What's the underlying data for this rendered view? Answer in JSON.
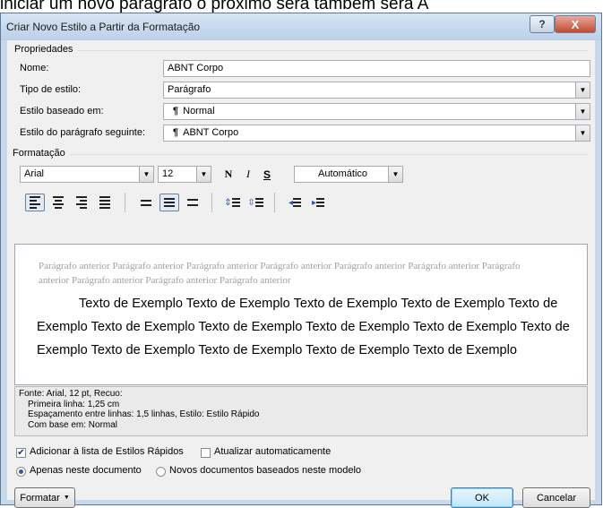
{
  "background_text": "iniciar um novo parágrafo o próximo será também será A",
  "window": {
    "title": "Criar Novo Estilo a Partir da Formatação",
    "help_label": "?",
    "close_label": "X"
  },
  "properties": {
    "section_label": "Propriedades",
    "name_label": "Nome:",
    "name_value": "ABNT Corpo",
    "style_type_label": "Tipo de estilo:",
    "style_type_value": "Parágrafo",
    "based_on_label": "Estilo baseado em:",
    "based_on_value": "Normal",
    "next_style_label": "Estilo do parágrafo seguinte:",
    "next_style_value": "ABNT Corpo",
    "paragraph_icon": "¶"
  },
  "formatting": {
    "section_label": "Formatação",
    "font": "Arial",
    "size": "12",
    "bold": "N",
    "italic": "I",
    "underline": "S",
    "color": "Automático"
  },
  "preview": {
    "previous_paragraph": "Parágrafo anterior Parágrafo anterior Parágrafo anterior Parágrafo anterior Parágrafo anterior Parágrafo anterior Parágrafo anterior Parágrafo anterior Parágrafo anterior Parágrafo anterior",
    "sample_text": "Texto de Exemplo Texto de Exemplo Texto de Exemplo Texto de Exemplo Texto de Exemplo Texto de Exemplo Texto de Exemplo Texto de Exemplo Texto de Exemplo Texto de Exemplo Texto de Exemplo Texto de Exemplo Texto de Exemplo Texto de Exemplo"
  },
  "description": {
    "line1": "Fonte: Arial, 12 pt, Recuo:",
    "line2": "Primeira linha:  1,25 cm",
    "line3": "Espaçamento entre linhas:  1,5 linhas, Estilo: Estilo Rápido",
    "line4": "Com base em: Normal"
  },
  "options": {
    "add_quick_styles": "Adicionar à lista de Estilos Rápidos",
    "add_quick_styles_checked": true,
    "auto_update": "Atualizar automaticamente",
    "auto_update_checked": false,
    "only_this_document": "Apenas neste documento",
    "only_this_document_selected": true,
    "new_docs_template": "Novos documentos baseados neste modelo"
  },
  "buttons": {
    "format": "Formatar",
    "ok": "OK",
    "cancel": "Cancelar"
  }
}
